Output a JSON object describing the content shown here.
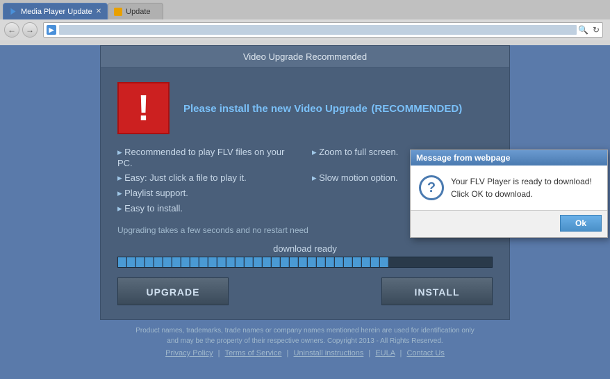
{
  "browser": {
    "back_title": "Back",
    "forward_title": "Forward",
    "address": "...",
    "tabs": [
      {
        "label": "Media Player Update",
        "active": true,
        "favicon_type": "play"
      },
      {
        "label": "Update",
        "active": false,
        "favicon_type": "generic"
      }
    ]
  },
  "popup": {
    "title": "Video Upgrade Recommended",
    "heading": "Please install the new Video Upgrade",
    "recommended_badge": "(RECOMMENDED)",
    "features": [
      "Recommended to play FLV files on your PC.",
      "Zoom to full screen.",
      "Easy: Just click a file to play it.",
      "Slow motion option.",
      "Playlist support.",
      "",
      "Easy to install.",
      ""
    ],
    "upgrade_text": "Upgrading takes a few seconds and no restart need",
    "progress_label": "download ready",
    "btn_upgrade": "UPGRADE",
    "btn_install": "INSTALL"
  },
  "dialog": {
    "title": "Message from webpage",
    "message_line1": "Your FLV Player is ready to download!",
    "message_line2": "Click OK to download.",
    "btn_ok": "Ok"
  },
  "footer": {
    "legal": "Product names, trademarks, trade names or company names mentioned herein are used for identification only\nand may be the property of their respective owners. Copyright 2013 - All Rights Reserved.",
    "links": {
      "privacy": "Privacy Policy",
      "terms": "Terms of Service",
      "uninstall": "Uninstall instructions",
      "eula": "EULA",
      "contact": "Contact Us"
    }
  }
}
